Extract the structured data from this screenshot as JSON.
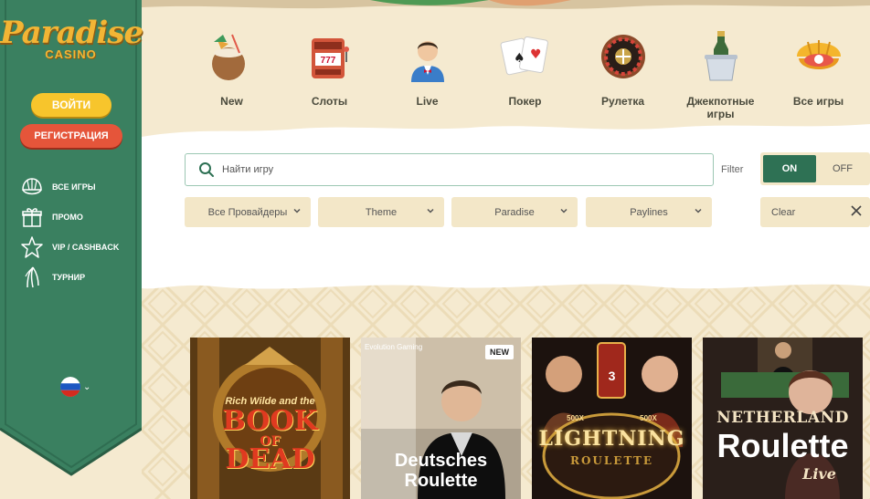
{
  "brand": {
    "name": "Paradise",
    "sub": "CASINO"
  },
  "auth": {
    "login": "ВОЙТИ",
    "register": "РЕГИСТРАЦИЯ"
  },
  "side_nav": [
    {
      "label": "ВСЕ ИГРЫ",
      "icon": "shell-icon"
    },
    {
      "label": "ПРОМО",
      "icon": "gift-icon"
    },
    {
      "label": "VIP / CASHBACK",
      "icon": "starfish-icon"
    },
    {
      "label": "ТУРНИР",
      "icon": "palm-leaf-icon"
    }
  ],
  "language": {
    "icon": "russia-flag-icon"
  },
  "categories": [
    {
      "label": "New",
      "icon": "coconut-cocktail-icon"
    },
    {
      "label": "Слоты",
      "icon": "slot-machine-icon"
    },
    {
      "label": "Live",
      "icon": "dealer-icon"
    },
    {
      "label": "Покер",
      "icon": "playing-cards-icon"
    },
    {
      "label": "Рулетка",
      "icon": "roulette-wheel-icon"
    },
    {
      "label": "Джекпотные игры",
      "icon": "champagne-bucket-icon"
    },
    {
      "label": "Все игры",
      "icon": "pearl-shell-icon"
    }
  ],
  "search": {
    "placeholder": "Найти игру"
  },
  "filter": {
    "label": "Filter",
    "on": "ON",
    "off": "OFF",
    "state": "ON"
  },
  "dropdowns": [
    "Все Провайдеры",
    "Theme",
    "Paradise",
    "Paylines"
  ],
  "clear": {
    "label": "Clear"
  },
  "games": [
    {
      "title_lines": [
        "Rich Wilde and the",
        "BOOK",
        "OF",
        "DEAD"
      ],
      "badge": ""
    },
    {
      "title_lines": [
        "Evolution Gaming",
        "Deutsches",
        "Roulette"
      ],
      "badge": "NEW"
    },
    {
      "title_lines": [
        "3",
        "LIGHTNING",
        "ROULETTE",
        "500X",
        "500X"
      ],
      "badge": ""
    },
    {
      "title_lines": [
        "NETHERLAND",
        "Roulette",
        "Live"
      ],
      "badge": ""
    }
  ],
  "colors": {
    "sidebar_green": "#3a8060",
    "accent_green": "#2e7154",
    "login_yellow": "#f7c52c",
    "register_red": "#e5553a",
    "sand": "#f5ead0"
  }
}
